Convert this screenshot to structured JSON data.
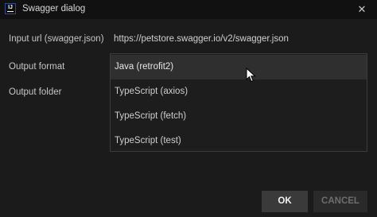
{
  "window": {
    "title": "Swagger dialog",
    "app_icon_text": "IJ",
    "close_glyph": "✕"
  },
  "form": {
    "input_url_label": "Input url (swagger.json)",
    "input_url_value": "https://petstore.swagger.io/v2/swagger.json",
    "output_format_label": "Output format",
    "output_folder_label": "Output folder"
  },
  "dropdown": {
    "options": [
      "Java (retrofit2)",
      "TypeScript (axios)",
      "TypeScript (fetch)",
      "TypeScript (test)"
    ],
    "selected": "Java (retrofit2)"
  },
  "buttons": {
    "ok": "OK",
    "cancel": "CANCEL"
  },
  "colors": {
    "background": "#1b1b1b",
    "titlebar": "#111111",
    "selected_option": "#2f2f2f",
    "ok_button": "#3a3a3a",
    "cancel_button": "#2a2a2a"
  },
  "icons": {
    "app": "intellij-icon",
    "close": "close-icon",
    "cursor": "mouse-pointer-icon"
  }
}
